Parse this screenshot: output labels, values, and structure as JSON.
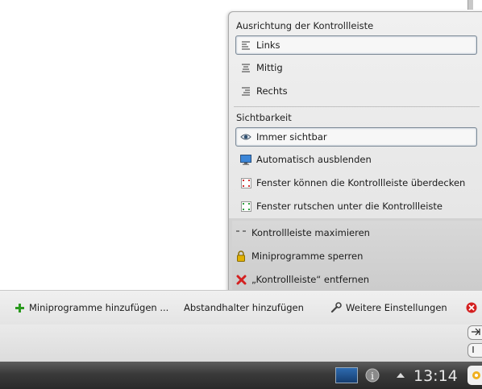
{
  "popup": {
    "alignment_title": "Ausrichtung der Kontrollleiste",
    "alignment_items": [
      {
        "label": "Links",
        "selected": true
      },
      {
        "label": "Mittig",
        "selected": false
      },
      {
        "label": "Rechts",
        "selected": false
      }
    ],
    "visibility_title": "Sichtbarkeit",
    "visibility_items": [
      {
        "label": "Immer sichtbar",
        "selected": true
      },
      {
        "label": "Automatisch ausblenden",
        "selected": false
      },
      {
        "label": "Fenster können die Kontrollleiste überdecken",
        "selected": false
      },
      {
        "label": "Fenster rutschen unter die Kontrollleiste",
        "selected": false
      }
    ],
    "actions": [
      {
        "label": "Kontrollleiste maximieren",
        "icon": "maximize-icon"
      },
      {
        "label": "Miniprogramme sperren",
        "icon": "lock-icon"
      },
      {
        "label": "„Kontrollleiste“ entfernen",
        "icon": "remove-icon"
      }
    ]
  },
  "toolbar": {
    "add_widgets": "Miniprogramme hinzufügen ...",
    "add_spacer": "Abstandhalter hinzufügen",
    "more_settings": "Weitere Einstellungen"
  },
  "taskbar": {
    "clock": "13:14"
  },
  "colors": {
    "add_green": "#2a9a1e",
    "remove_red": "#d42020",
    "lock_yellow": "#e0b000"
  }
}
